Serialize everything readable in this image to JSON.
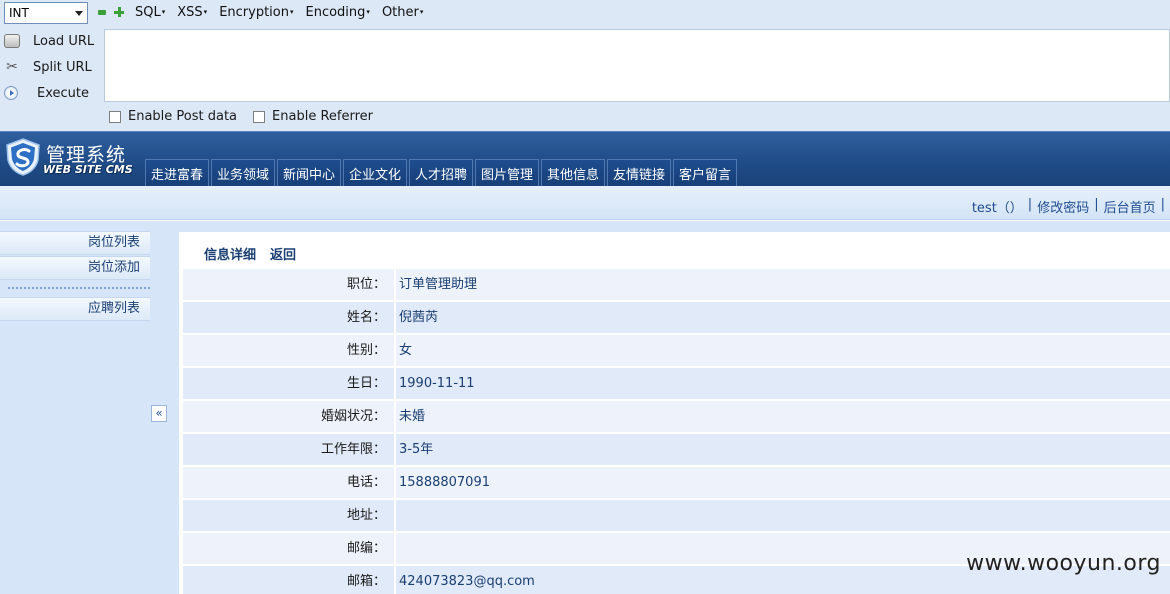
{
  "hackbar": {
    "select_value": "INT",
    "menus": [
      "SQL",
      "XSS",
      "Encryption",
      "Encoding",
      "Other"
    ],
    "buttons": {
      "load": "Load URL",
      "split": "Split URL",
      "execute": "Execute"
    },
    "url_value": "",
    "checkboxes": {
      "post": "Enable Post data",
      "referrer": "Enable Referrer"
    }
  },
  "header": {
    "logo_title": "管理系统",
    "logo_sub": "WEB SITE CMS",
    "nav": [
      "走进富春",
      "业务领域",
      "新闻中心",
      "企业文化",
      "人才招聘",
      "图片管理",
      "其他信息",
      "友情链接",
      "客户留言"
    ]
  },
  "userbar": {
    "user": "test（）",
    "change_password": "修改密码",
    "home": "后台首页"
  },
  "sidebar": {
    "items": [
      "岗位列表",
      "岗位添加",
      "应聘列表"
    ],
    "collapse": "«"
  },
  "detail": {
    "head_title": "信息详细",
    "back": "返回",
    "fields": [
      {
        "label": "职位：",
        "value": "订单管理助理"
      },
      {
        "label": "姓名：",
        "value": "倪茜芮"
      },
      {
        "label": "性别：",
        "value": "女"
      },
      {
        "label": "生日：",
        "value": "1990-11-11"
      },
      {
        "label": "婚姻状况：",
        "value": "未婚"
      },
      {
        "label": "工作年限：",
        "value": "3-5年"
      },
      {
        "label": "电话：",
        "value": "15888807091"
      },
      {
        "label": "地址：",
        "value": ""
      },
      {
        "label": "邮编：",
        "value": ""
      },
      {
        "label": "邮箱：",
        "value": "424073823@qq.com"
      }
    ]
  },
  "watermark": "www.wooyun.org"
}
